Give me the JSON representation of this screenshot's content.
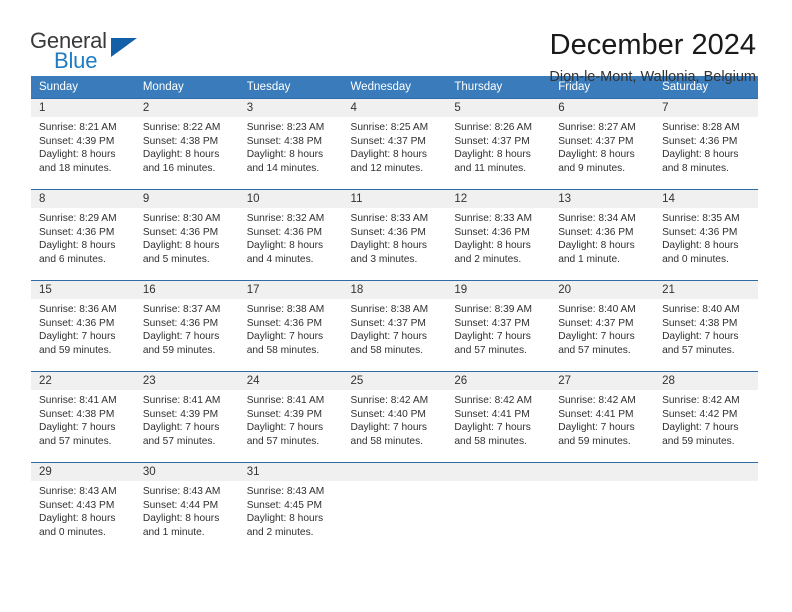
{
  "brand": {
    "name_part1": "General",
    "name_part2": "Blue",
    "logo_icon": "triangle-logo-icon"
  },
  "header": {
    "title": "December 2024",
    "subtitle": "Dion-le-Mont, Wallonia, Belgium"
  },
  "colors": {
    "header_band": "#3a7cbb",
    "week_divider": "#2e6da4",
    "daynum_bg": "#f0f0f0",
    "brand_blue": "#1f7cc2",
    "logo_blue": "#1460a8"
  },
  "weekday_headers": [
    "Sunday",
    "Monday",
    "Tuesday",
    "Wednesday",
    "Thursday",
    "Friday",
    "Saturday"
  ],
  "weeks": [
    [
      {
        "day": "1",
        "sunrise": "Sunrise: 8:21 AM",
        "sunset": "Sunset: 4:39 PM",
        "daylight1": "Daylight: 8 hours",
        "daylight2": "and 18 minutes."
      },
      {
        "day": "2",
        "sunrise": "Sunrise: 8:22 AM",
        "sunset": "Sunset: 4:38 PM",
        "daylight1": "Daylight: 8 hours",
        "daylight2": "and 16 minutes."
      },
      {
        "day": "3",
        "sunrise": "Sunrise: 8:23 AM",
        "sunset": "Sunset: 4:38 PM",
        "daylight1": "Daylight: 8 hours",
        "daylight2": "and 14 minutes."
      },
      {
        "day": "4",
        "sunrise": "Sunrise: 8:25 AM",
        "sunset": "Sunset: 4:37 PM",
        "daylight1": "Daylight: 8 hours",
        "daylight2": "and 12 minutes."
      },
      {
        "day": "5",
        "sunrise": "Sunrise: 8:26 AM",
        "sunset": "Sunset: 4:37 PM",
        "daylight1": "Daylight: 8 hours",
        "daylight2": "and 11 minutes."
      },
      {
        "day": "6",
        "sunrise": "Sunrise: 8:27 AM",
        "sunset": "Sunset: 4:37 PM",
        "daylight1": "Daylight: 8 hours",
        "daylight2": "and 9 minutes."
      },
      {
        "day": "7",
        "sunrise": "Sunrise: 8:28 AM",
        "sunset": "Sunset: 4:36 PM",
        "daylight1": "Daylight: 8 hours",
        "daylight2": "and 8 minutes."
      }
    ],
    [
      {
        "day": "8",
        "sunrise": "Sunrise: 8:29 AM",
        "sunset": "Sunset: 4:36 PM",
        "daylight1": "Daylight: 8 hours",
        "daylight2": "and 6 minutes."
      },
      {
        "day": "9",
        "sunrise": "Sunrise: 8:30 AM",
        "sunset": "Sunset: 4:36 PM",
        "daylight1": "Daylight: 8 hours",
        "daylight2": "and 5 minutes."
      },
      {
        "day": "10",
        "sunrise": "Sunrise: 8:32 AM",
        "sunset": "Sunset: 4:36 PM",
        "daylight1": "Daylight: 8 hours",
        "daylight2": "and 4 minutes."
      },
      {
        "day": "11",
        "sunrise": "Sunrise: 8:33 AM",
        "sunset": "Sunset: 4:36 PM",
        "daylight1": "Daylight: 8 hours",
        "daylight2": "and 3 minutes."
      },
      {
        "day": "12",
        "sunrise": "Sunrise: 8:33 AM",
        "sunset": "Sunset: 4:36 PM",
        "daylight1": "Daylight: 8 hours",
        "daylight2": "and 2 minutes."
      },
      {
        "day": "13",
        "sunrise": "Sunrise: 8:34 AM",
        "sunset": "Sunset: 4:36 PM",
        "daylight1": "Daylight: 8 hours",
        "daylight2": "and 1 minute."
      },
      {
        "day": "14",
        "sunrise": "Sunrise: 8:35 AM",
        "sunset": "Sunset: 4:36 PM",
        "daylight1": "Daylight: 8 hours",
        "daylight2": "and 0 minutes."
      }
    ],
    [
      {
        "day": "15",
        "sunrise": "Sunrise: 8:36 AM",
        "sunset": "Sunset: 4:36 PM",
        "daylight1": "Daylight: 7 hours",
        "daylight2": "and 59 minutes."
      },
      {
        "day": "16",
        "sunrise": "Sunrise: 8:37 AM",
        "sunset": "Sunset: 4:36 PM",
        "daylight1": "Daylight: 7 hours",
        "daylight2": "and 59 minutes."
      },
      {
        "day": "17",
        "sunrise": "Sunrise: 8:38 AM",
        "sunset": "Sunset: 4:36 PM",
        "daylight1": "Daylight: 7 hours",
        "daylight2": "and 58 minutes."
      },
      {
        "day": "18",
        "sunrise": "Sunrise: 8:38 AM",
        "sunset": "Sunset: 4:37 PM",
        "daylight1": "Daylight: 7 hours",
        "daylight2": "and 58 minutes."
      },
      {
        "day": "19",
        "sunrise": "Sunrise: 8:39 AM",
        "sunset": "Sunset: 4:37 PM",
        "daylight1": "Daylight: 7 hours",
        "daylight2": "and 57 minutes."
      },
      {
        "day": "20",
        "sunrise": "Sunrise: 8:40 AM",
        "sunset": "Sunset: 4:37 PM",
        "daylight1": "Daylight: 7 hours",
        "daylight2": "and 57 minutes."
      },
      {
        "day": "21",
        "sunrise": "Sunrise: 8:40 AM",
        "sunset": "Sunset: 4:38 PM",
        "daylight1": "Daylight: 7 hours",
        "daylight2": "and 57 minutes."
      }
    ],
    [
      {
        "day": "22",
        "sunrise": "Sunrise: 8:41 AM",
        "sunset": "Sunset: 4:38 PM",
        "daylight1": "Daylight: 7 hours",
        "daylight2": "and 57 minutes."
      },
      {
        "day": "23",
        "sunrise": "Sunrise: 8:41 AM",
        "sunset": "Sunset: 4:39 PM",
        "daylight1": "Daylight: 7 hours",
        "daylight2": "and 57 minutes."
      },
      {
        "day": "24",
        "sunrise": "Sunrise: 8:41 AM",
        "sunset": "Sunset: 4:39 PM",
        "daylight1": "Daylight: 7 hours",
        "daylight2": "and 57 minutes."
      },
      {
        "day": "25",
        "sunrise": "Sunrise: 8:42 AM",
        "sunset": "Sunset: 4:40 PM",
        "daylight1": "Daylight: 7 hours",
        "daylight2": "and 58 minutes."
      },
      {
        "day": "26",
        "sunrise": "Sunrise: 8:42 AM",
        "sunset": "Sunset: 4:41 PM",
        "daylight1": "Daylight: 7 hours",
        "daylight2": "and 58 minutes."
      },
      {
        "day": "27",
        "sunrise": "Sunrise: 8:42 AM",
        "sunset": "Sunset: 4:41 PM",
        "daylight1": "Daylight: 7 hours",
        "daylight2": "and 59 minutes."
      },
      {
        "day": "28",
        "sunrise": "Sunrise: 8:42 AM",
        "sunset": "Sunset: 4:42 PM",
        "daylight1": "Daylight: 7 hours",
        "daylight2": "and 59 minutes."
      }
    ],
    [
      {
        "day": "29",
        "sunrise": "Sunrise: 8:43 AM",
        "sunset": "Sunset: 4:43 PM",
        "daylight1": "Daylight: 8 hours",
        "daylight2": "and 0 minutes."
      },
      {
        "day": "30",
        "sunrise": "Sunrise: 8:43 AM",
        "sunset": "Sunset: 4:44 PM",
        "daylight1": "Daylight: 8 hours",
        "daylight2": "and 1 minute."
      },
      {
        "day": "31",
        "sunrise": "Sunrise: 8:43 AM",
        "sunset": "Sunset: 4:45 PM",
        "daylight1": "Daylight: 8 hours",
        "daylight2": "and 2 minutes."
      },
      {
        "day": "",
        "sunrise": "",
        "sunset": "",
        "daylight1": "",
        "daylight2": ""
      },
      {
        "day": "",
        "sunrise": "",
        "sunset": "",
        "daylight1": "",
        "daylight2": ""
      },
      {
        "day": "",
        "sunrise": "",
        "sunset": "",
        "daylight1": "",
        "daylight2": ""
      },
      {
        "day": "",
        "sunrise": "",
        "sunset": "",
        "daylight1": "",
        "daylight2": ""
      }
    ]
  ]
}
